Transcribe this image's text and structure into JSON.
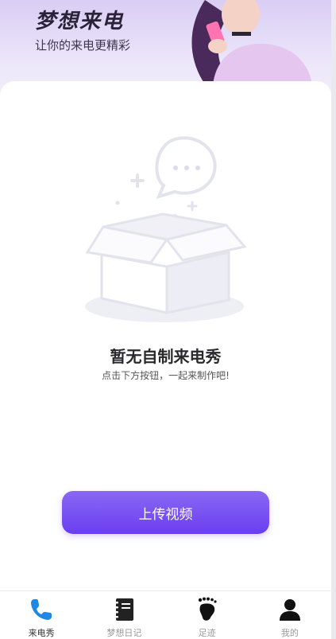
{
  "header": {
    "title": "梦想来电",
    "subtitle": "让你的来电更精彩"
  },
  "empty": {
    "title": "暂无自制来电秀",
    "subtitle": "点击下方按钮，一起来制作吧!"
  },
  "actions": {
    "upload_label": "上传视频"
  },
  "tabs": [
    {
      "label": "来电秀",
      "icon": "phone-icon",
      "active": true
    },
    {
      "label": "梦想日记",
      "icon": "notebook-icon",
      "active": false
    },
    {
      "label": "足迹",
      "icon": "footprint-icon",
      "active": false
    },
    {
      "label": "我的",
      "icon": "person-icon",
      "active": false
    }
  ],
  "colors": {
    "accent": "#6a3ef0",
    "active_tab_icon": "#1e88e5",
    "header_bg": "#d9cdf4"
  }
}
